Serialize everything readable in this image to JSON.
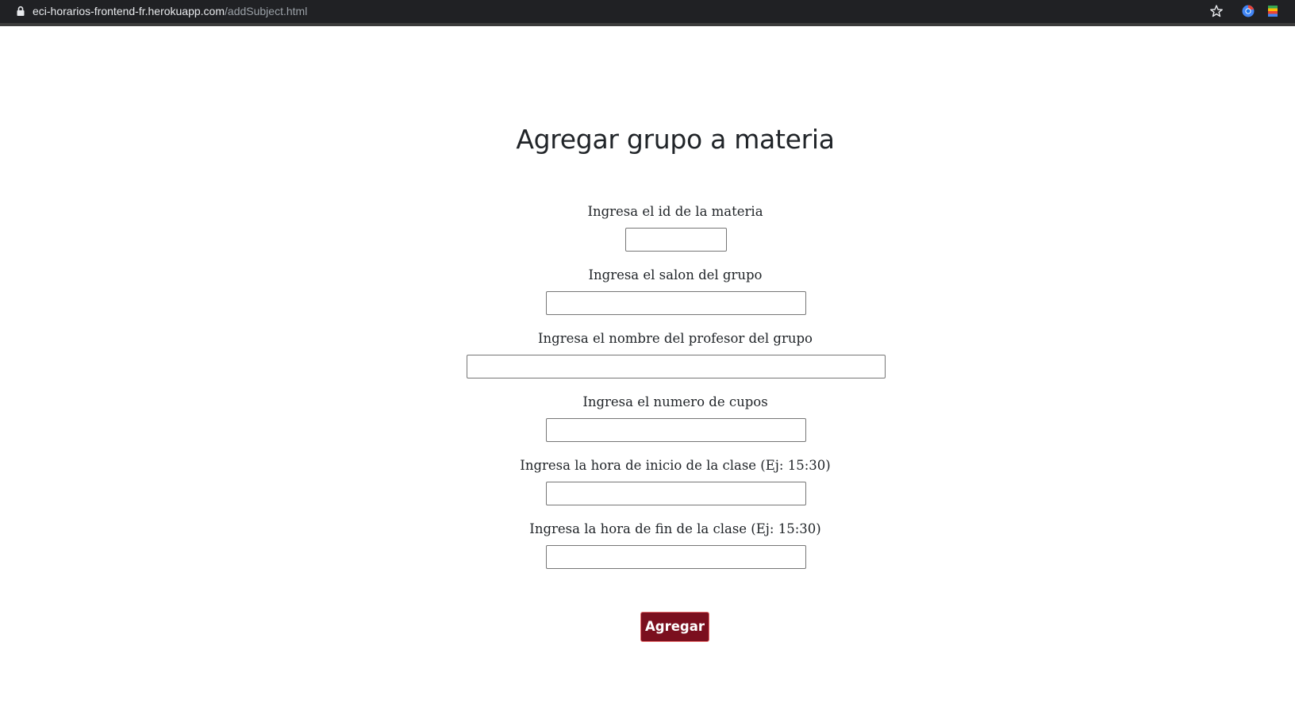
{
  "browser": {
    "url_domain": "eci-horarios-frontend-fr.herokuapp.com",
    "url_path": "/addSubject.html"
  },
  "page": {
    "title": "Agregar grupo a materia"
  },
  "form": {
    "fields": [
      {
        "label": "Ingresa el id de la materia",
        "value": ""
      },
      {
        "label": "Ingresa el salon del grupo",
        "value": ""
      },
      {
        "label": "Ingresa el nombre del profesor del grupo",
        "value": ""
      },
      {
        "label": "Ingresa el numero de cupos",
        "value": ""
      },
      {
        "label": "Ingresa la hora de inicio de la clase (Ej: 15:30)",
        "value": ""
      },
      {
        "label": "Ingresa la hora de fin de la clase (Ej: 15:30)",
        "value": ""
      }
    ],
    "submit_label": "Agregar"
  },
  "colors": {
    "button_bg": "#7b0f1e",
    "button_border": "#e66a6a",
    "chrome_bg": "#202124"
  },
  "icons": {
    "lock": "lock-icon",
    "bookmark": "star-icon",
    "extension_1": "chrome-extension-icon",
    "extension_2": "google-extension-icon"
  }
}
